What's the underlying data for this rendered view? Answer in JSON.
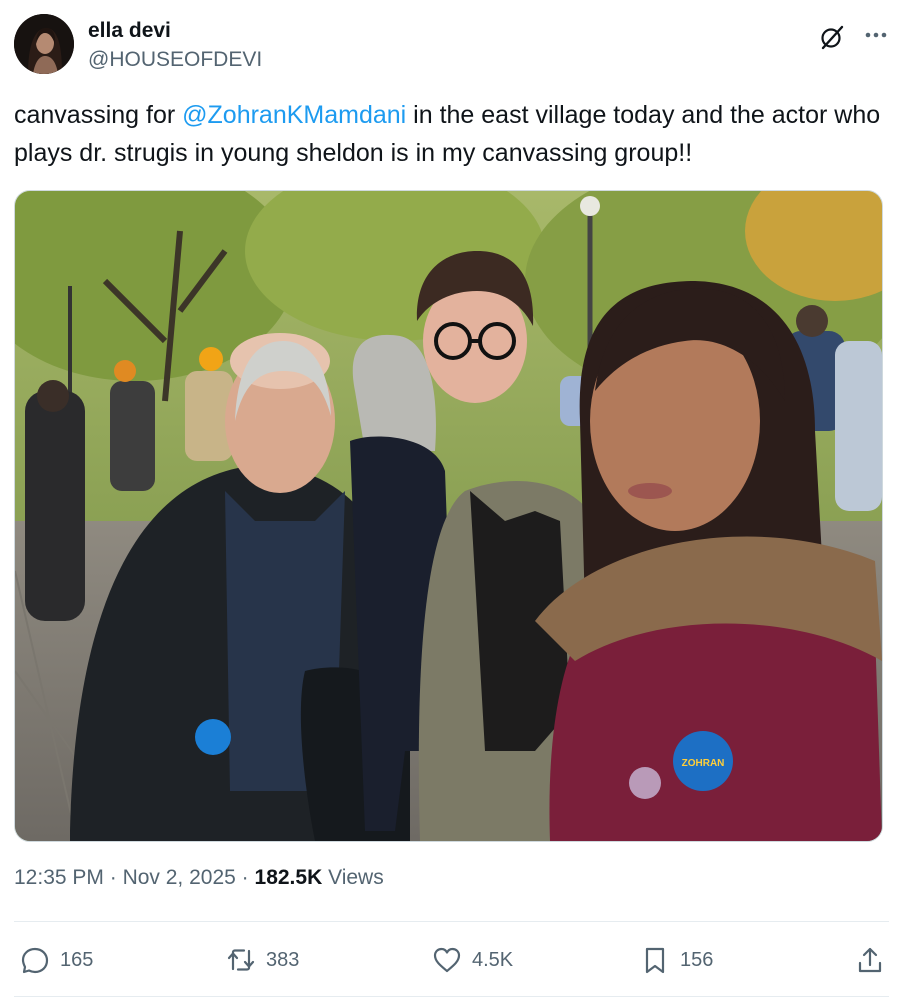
{
  "author": {
    "display_name": "ella devi",
    "handle": "@HOUSEOFDEVI",
    "avatar_icon": "profile-avatar"
  },
  "tweet": {
    "text_before": "canvassing for ",
    "mention": "@ZohranKMamdani",
    "text_after": " in the east village today and the actor who plays dr. strugis in young sheldon is in my canvassing group!!",
    "image_badge_text": "ZOHRAN"
  },
  "meta": {
    "time": "12:35 PM",
    "separator": "·",
    "date": "Nov 2, 2025",
    "views_count": "182.5K",
    "views_label": "Views"
  },
  "actions": {
    "replies": "165",
    "reposts": "383",
    "likes": "4.5K",
    "bookmarks": "156"
  },
  "colors": {
    "link": "#1d9bf0",
    "secondary_text": "#536471",
    "primary_text": "#0f1419"
  },
  "icons": [
    "grok-icon",
    "more-icon",
    "reply-icon",
    "repost-icon",
    "like-icon",
    "bookmark-icon",
    "share-icon"
  ]
}
